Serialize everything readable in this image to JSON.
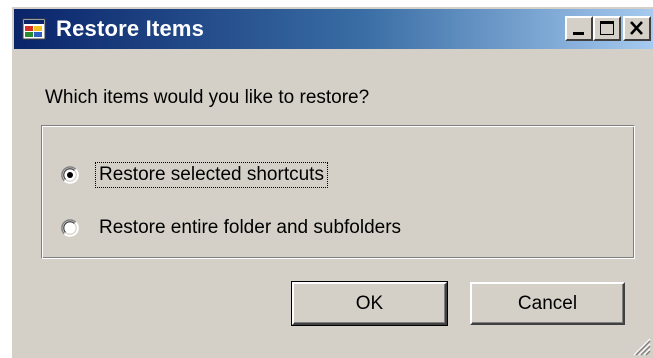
{
  "window": {
    "title": "Restore Items",
    "accent_color": "#0a246a",
    "title_gradient_end": "#a6caf0",
    "face_color": "#d4d0c8"
  },
  "icons": {
    "app": "restore-app-icon",
    "minimize": "minimize-icon",
    "maximize": "maximize-icon",
    "close": "close-icon",
    "grip": "resize-grip-icon"
  },
  "dialog": {
    "question": "Which items would you like to restore?",
    "options": [
      {
        "label": "Restore selected shortcuts",
        "selected": true
      },
      {
        "label": "Restore entire folder and subfolders",
        "selected": false
      }
    ],
    "ok_label": "OK",
    "cancel_label": "Cancel"
  }
}
